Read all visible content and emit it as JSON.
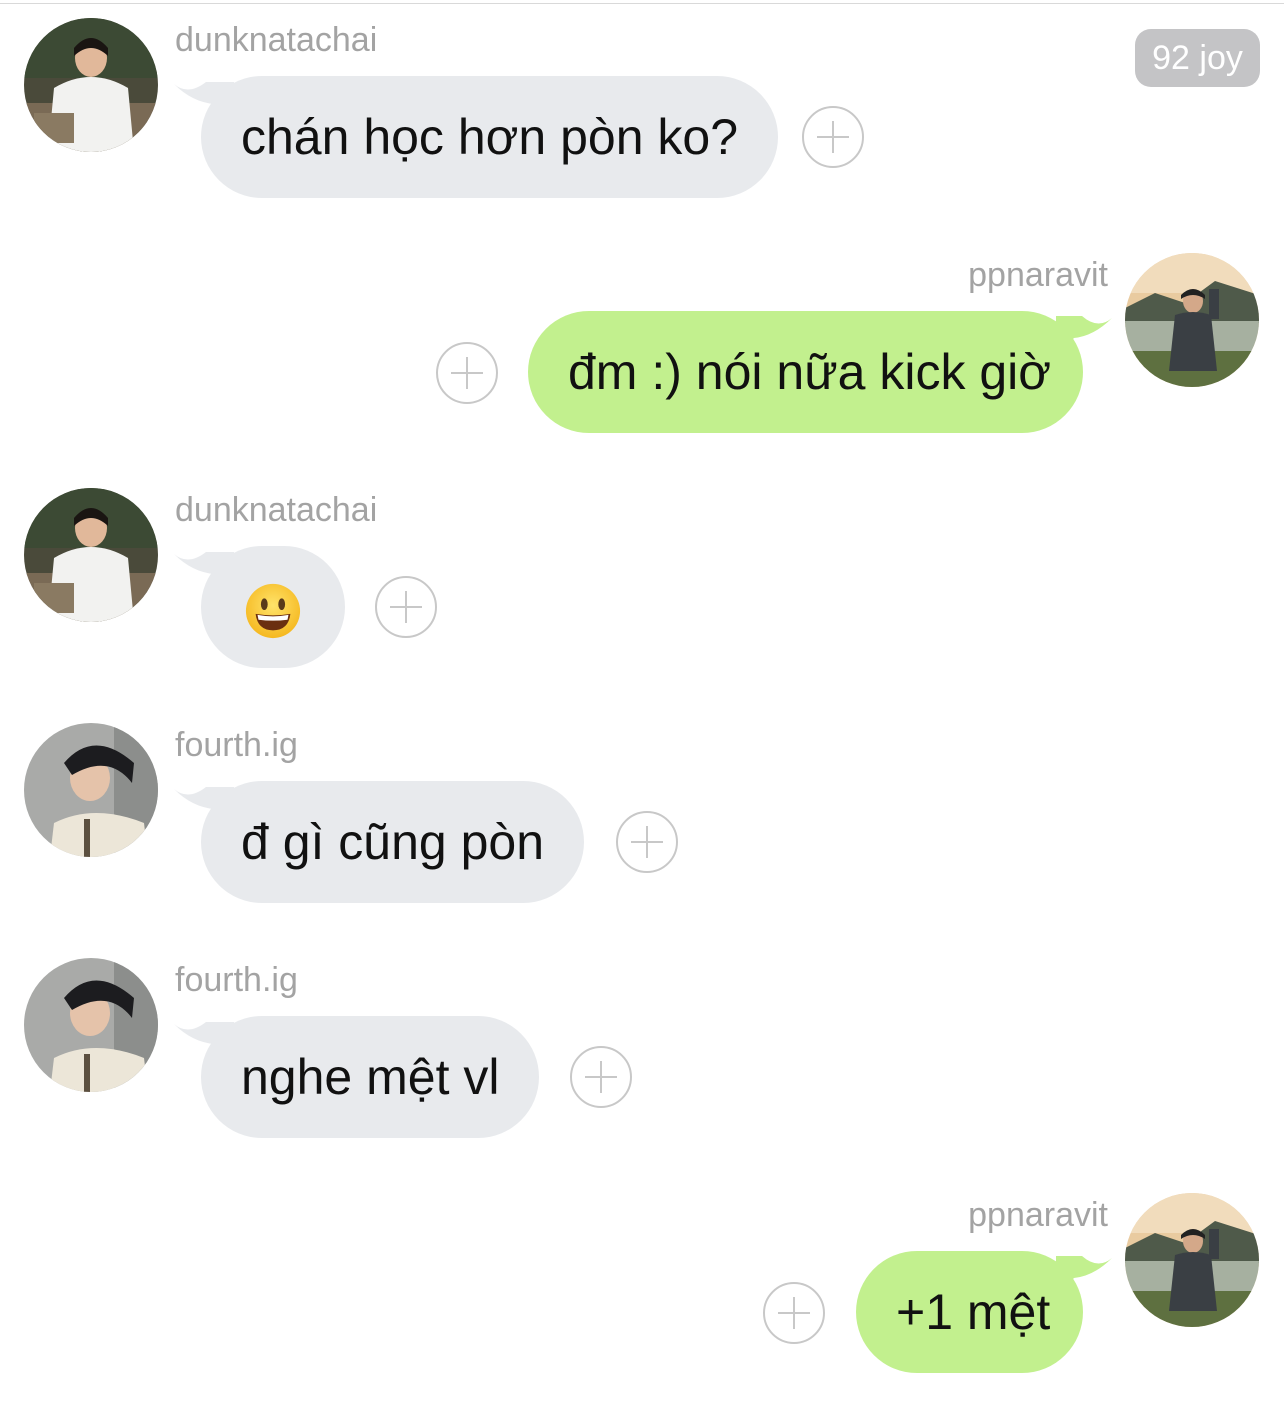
{
  "header": {
    "badge": "92 joy"
  },
  "messages": [
    {
      "sender": "dunknatachai",
      "side": "left",
      "text": "chán học hơn pòn ko?"
    },
    {
      "sender": "ppnaravit",
      "side": "right",
      "text": "đm :) nói nữa kick giờ"
    },
    {
      "sender": "dunknatachai",
      "side": "left",
      "emoji": "smiling-face-emoji"
    },
    {
      "sender": "fourth.ig",
      "side": "left",
      "text": "đ gì cũng pòn"
    },
    {
      "sender": "fourth.ig",
      "side": "left",
      "text": "nghe mệt vl"
    },
    {
      "sender": "ppnaravit",
      "side": "right",
      "text": "+1 mệt"
    }
  ],
  "icons": {
    "add_reaction": "plus-circle-icon",
    "emoji": "grinning-face-emoji"
  },
  "colors": {
    "incoming_bubble": "#e8eaed",
    "outgoing_bubble": "#c2f08e",
    "sender_name": "#a3a3a3",
    "badge_bg": "#c4c4c6"
  }
}
